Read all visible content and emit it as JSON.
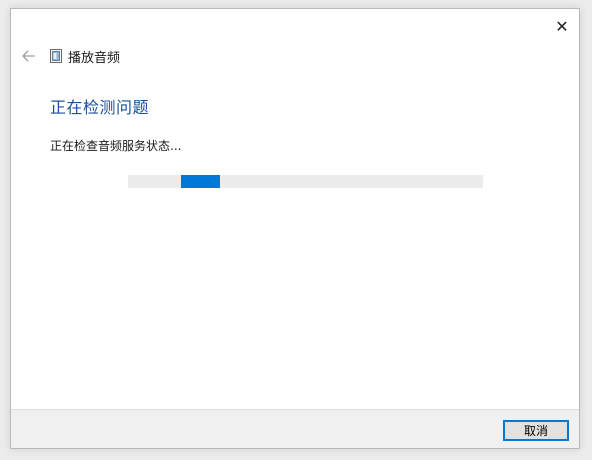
{
  "window": {
    "close_glyph": "✕"
  },
  "header": {
    "back_icon": "back-arrow-icon",
    "app_icon": "troubleshooter-icon",
    "title": "播放音频"
  },
  "main": {
    "heading": "正在检测问题",
    "status": "正在检查音频服务状态...",
    "progress": {
      "indeterminate": true,
      "chunk_start_fraction": 0.15,
      "chunk_width_fraction": 0.11,
      "color": "#0078d7"
    }
  },
  "footer": {
    "cancel_label": "取消"
  },
  "colors": {
    "heading": "#1a4f9c",
    "accent": "#0078d7",
    "track": "#ebebeb",
    "footer_bg": "#f0f0f0"
  }
}
